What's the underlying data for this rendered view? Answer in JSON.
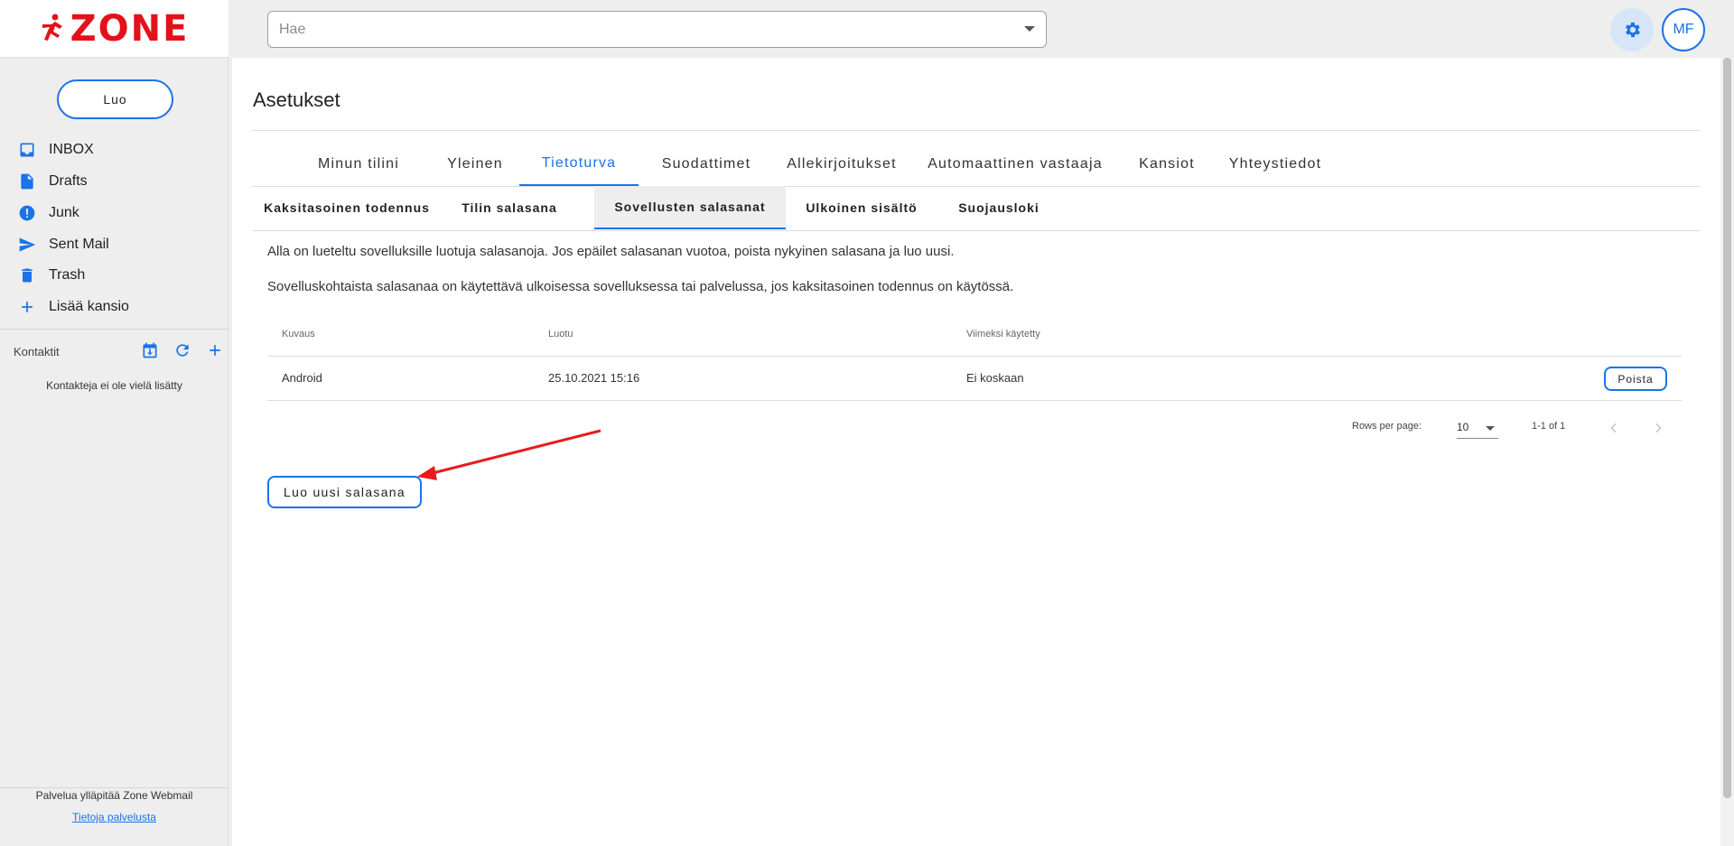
{
  "brand": {
    "name": "ZONE",
    "color": "#e3121a"
  },
  "accent_color": "#1a73e8",
  "search": {
    "placeholder": "Hae"
  },
  "header": {
    "settings_icon": "gear-icon",
    "avatar_initials": "MF"
  },
  "sidebar": {
    "create_label": "Luo",
    "folders": [
      {
        "label": "INBOX",
        "icon": "inbox-icon"
      },
      {
        "label": "Drafts",
        "icon": "document-icon"
      },
      {
        "label": "Junk",
        "icon": "alert-icon"
      },
      {
        "label": "Sent Mail",
        "icon": "send-icon"
      },
      {
        "label": "Trash",
        "icon": "trash-icon"
      },
      {
        "label": "Lisää kansio",
        "icon": "plus-icon"
      }
    ],
    "contacts_label": "Kontaktit",
    "contacts_empty": "Kontakteja ei ole vielä lisätty",
    "footer_text": "Palvelua ylläpitää Zone Webmail",
    "footer_link": "Tietoja palvelusta"
  },
  "main": {
    "title": "Asetukset",
    "tabs": [
      "Minun tilini",
      "Yleinen",
      "Tietoturva",
      "Suodattimet",
      "Allekirjoitukset",
      "Automaattinen vastaaja",
      "Kansiot",
      "Yhteystiedot"
    ],
    "active_tab": "Tietoturva",
    "subtabs": [
      "Kaksitasoinen todennus",
      "Tilin salasana",
      "Sovellusten salasanat",
      "Ulkoinen sisältö",
      "Suojausloki"
    ],
    "active_subtab": "Sovellusten salasanat",
    "paragraph1": "Alla on lueteltu sovelluksille luotuja salasanoja. Jos epäilet salasanan vuotoa, poista nykyinen salasana ja luo uusi.",
    "paragraph2": "Sovelluskohtaista salasanaa on käytettävä ulkoisessa sovelluksessa tai palvelussa, jos kaksitasoinen todennus on käytössä.",
    "table": {
      "headers": [
        "Kuvaus",
        "Luotu",
        "Viimeksi käytetty"
      ],
      "rows": [
        {
          "description": "Android",
          "created": "25.10.2021 15:16",
          "last_used": "Ei koskaan",
          "action": "Poista"
        }
      ]
    },
    "pagination": {
      "rows_per_page_label": "Rows per page:",
      "rows_per_page": "10",
      "range": "1-1 of 1"
    },
    "new_password_button": "Luo uusi salasana"
  }
}
